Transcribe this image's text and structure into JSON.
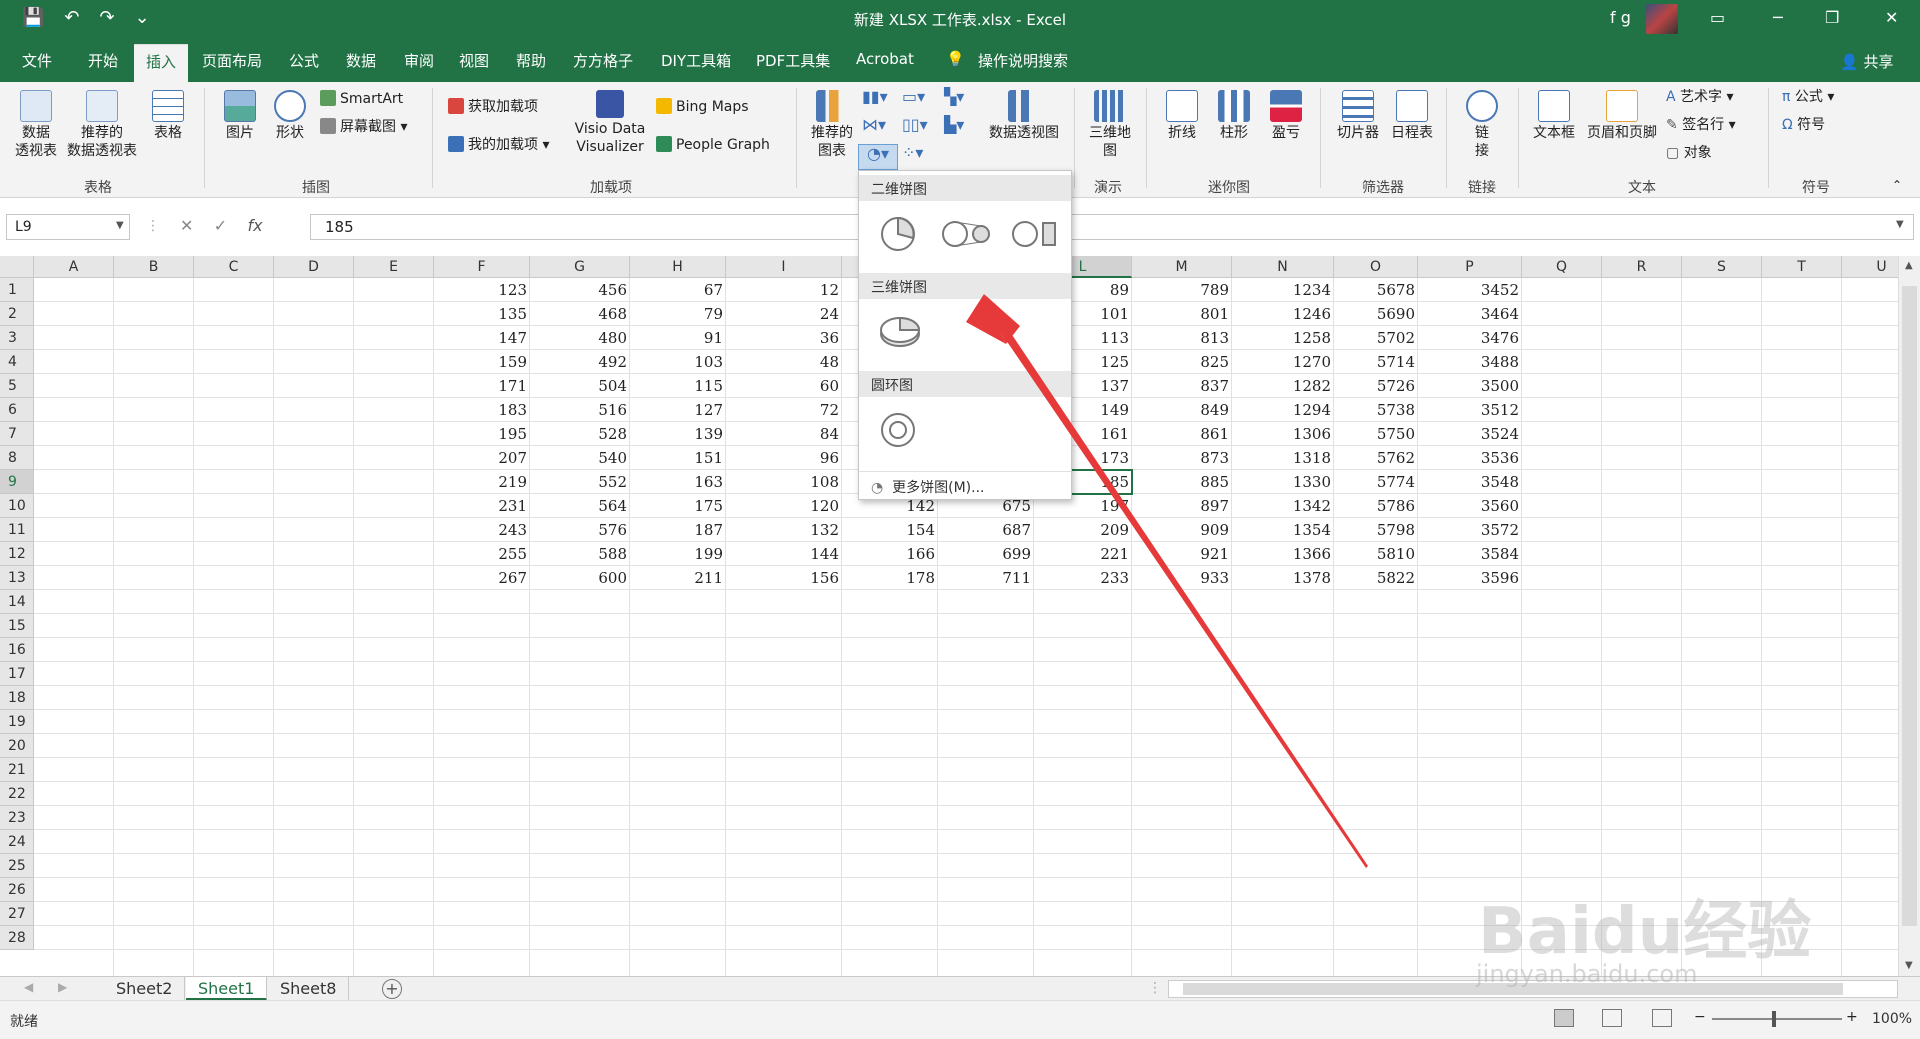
{
  "window": {
    "title": "新建 XLSX 工作表.xlsx  -  Excel",
    "user": "f g",
    "qat": [
      "💾",
      "↶",
      "↷",
      "⌄"
    ]
  },
  "tabs": [
    "文件",
    "开始",
    "插入",
    "页面布局",
    "公式",
    "数据",
    "审阅",
    "视图",
    "帮助",
    "方方格子",
    "DIY工具箱",
    "PDF工具集",
    "Acrobat"
  ],
  "tell_me": "操作说明搜索",
  "share": "共享",
  "ribbon": {
    "pivot": "数据\n透视表",
    "rec_pivot": "推荐的\n数据透视表",
    "table": "表格",
    "group_tables": "表格",
    "pictures": "图片",
    "shapes": "形状",
    "smartart": "SmartArt",
    "screenshot": "屏幕截图",
    "group_illustrations": "插图",
    "get_addins": "获取加载项",
    "my_addins": "我的加载项",
    "visio": "Visio Data\nVisualizer",
    "bing_maps": "Bing Maps",
    "people_graph": "People Graph",
    "group_addins": "加载项",
    "rec_charts": "推荐的\n图表",
    "pivot_chart": "数据透视图",
    "map3d": "三维地\n图",
    "group_tours": "演示",
    "line": "折线",
    "column": "柱形",
    "winloss": "盈亏",
    "group_sparklines": "迷你图",
    "slicer": "切片器",
    "timeline": "日程表",
    "group_filters": "筛选器",
    "link": "链\n接",
    "group_links": "链接",
    "textbox": "文本框",
    "header_footer": "页眉和页脚",
    "wordart": "艺术字",
    "signature": "签名行",
    "object": "对象",
    "group_text": "文本",
    "equation": "公式",
    "symbol": "符号",
    "group_symbols": "符号"
  },
  "formula_bar": {
    "name_box": "L9",
    "value": "185"
  },
  "columns": [
    "A",
    "B",
    "C",
    "D",
    "E",
    "F",
    "G",
    "H",
    "I",
    "J",
    "K",
    "L",
    "M",
    "N",
    "O",
    "P",
    "Q",
    "R",
    "S",
    "T",
    "U"
  ],
  "rows": [
    "1",
    "2",
    "3",
    "4",
    "5",
    "6",
    "7",
    "8",
    "9",
    "10",
    "11",
    "12",
    "13",
    "14",
    "15",
    "16",
    "17",
    "18",
    "19",
    "20",
    "21",
    "22",
    "23",
    "24",
    "25",
    "26",
    "27",
    "28"
  ],
  "cells": {
    "F": [
      "123",
      "135",
      "147",
      "159",
      "171",
      "183",
      "195",
      "207",
      "219",
      "231",
      "243",
      "255",
      "267"
    ],
    "G": [
      "456",
      "468",
      "480",
      "492",
      "504",
      "516",
      "528",
      "540",
      "552",
      "564",
      "576",
      "588",
      "600"
    ],
    "H": [
      "67",
      "79",
      "91",
      "103",
      "115",
      "127",
      "139",
      "151",
      "163",
      "175",
      "187",
      "199",
      "211"
    ],
    "I": [
      "12",
      "24",
      "36",
      "48",
      "60",
      "72",
      "84",
      "96",
      "108",
      "120",
      "132",
      "144",
      "156"
    ],
    "J": [
      "",
      "",
      "",
      "",
      "",
      "",
      "",
      "",
      "",
      "142",
      "154",
      "166",
      "178"
    ],
    "K": [
      "",
      "",
      "",
      "",
      "",
      "",
      "",
      "",
      "",
      "675",
      "687",
      "699",
      "711"
    ],
    "L": [
      "89",
      "101",
      "113",
      "125",
      "137",
      "149",
      "161",
      "173",
      "185",
      "197",
      "209",
      "221",
      "233"
    ],
    "M": [
      "789",
      "801",
      "813",
      "825",
      "837",
      "849",
      "861",
      "873",
      "885",
      "897",
      "909",
      "921",
      "933"
    ],
    "N": [
      "1234",
      "1246",
      "1258",
      "1270",
      "1282",
      "1294",
      "1306",
      "1318",
      "1330",
      "1342",
      "1354",
      "1366",
      "1378"
    ],
    "O": [
      "5678",
      "5690",
      "5702",
      "5714",
      "5726",
      "5738",
      "5750",
      "5762",
      "5774",
      "5786",
      "5798",
      "5810",
      "5822"
    ],
    "P": [
      "3452",
      "3464",
      "3476",
      "3488",
      "3500",
      "3512",
      "3524",
      "3536",
      "3548",
      "3560",
      "3572",
      "3584",
      "3596"
    ]
  },
  "pie_menu": {
    "section_2d": "二维饼图",
    "section_3d": "三维饼图",
    "section_donut": "圆环图",
    "more": "更多饼图(M)..."
  },
  "sheets": [
    "Sheet2",
    "Sheet1",
    "Sheet8"
  ],
  "active_sheet": "Sheet1",
  "status": {
    "ready": "就绪",
    "zoom": "100%"
  },
  "watermark": {
    "logo": "Baidu经验",
    "url": "jingyan.baidu.com"
  },
  "colors": {
    "excel_green": "#217346",
    "ribbon_bg": "#f3f3f3",
    "arrow_red": "#e63a3a"
  }
}
